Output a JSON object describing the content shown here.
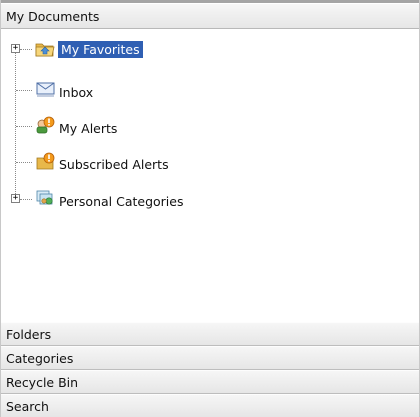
{
  "panel": {
    "header": "My Documents"
  },
  "tree": {
    "items": [
      {
        "label": "My Favorites",
        "icon": "favorites-folder-icon",
        "expandable": true,
        "selected": true
      },
      {
        "label": "Inbox",
        "icon": "inbox-envelope-icon",
        "expandable": false,
        "selected": false
      },
      {
        "label": "My Alerts",
        "icon": "my-alerts-icon",
        "expandable": false,
        "selected": false
      },
      {
        "label": "Subscribed Alerts",
        "icon": "subscribed-alerts-icon",
        "expandable": false,
        "selected": false
      },
      {
        "label": "Personal Categories",
        "icon": "personal-categories-icon",
        "expandable": true,
        "selected": false
      }
    ]
  },
  "sections": [
    {
      "label": "Folders"
    },
    {
      "label": "Categories"
    },
    {
      "label": "Recycle Bin"
    },
    {
      "label": "Search"
    }
  ],
  "colors": {
    "selection": "#2f5fb3",
    "header_bg": "#ececec",
    "border": "#c2c2c2"
  }
}
